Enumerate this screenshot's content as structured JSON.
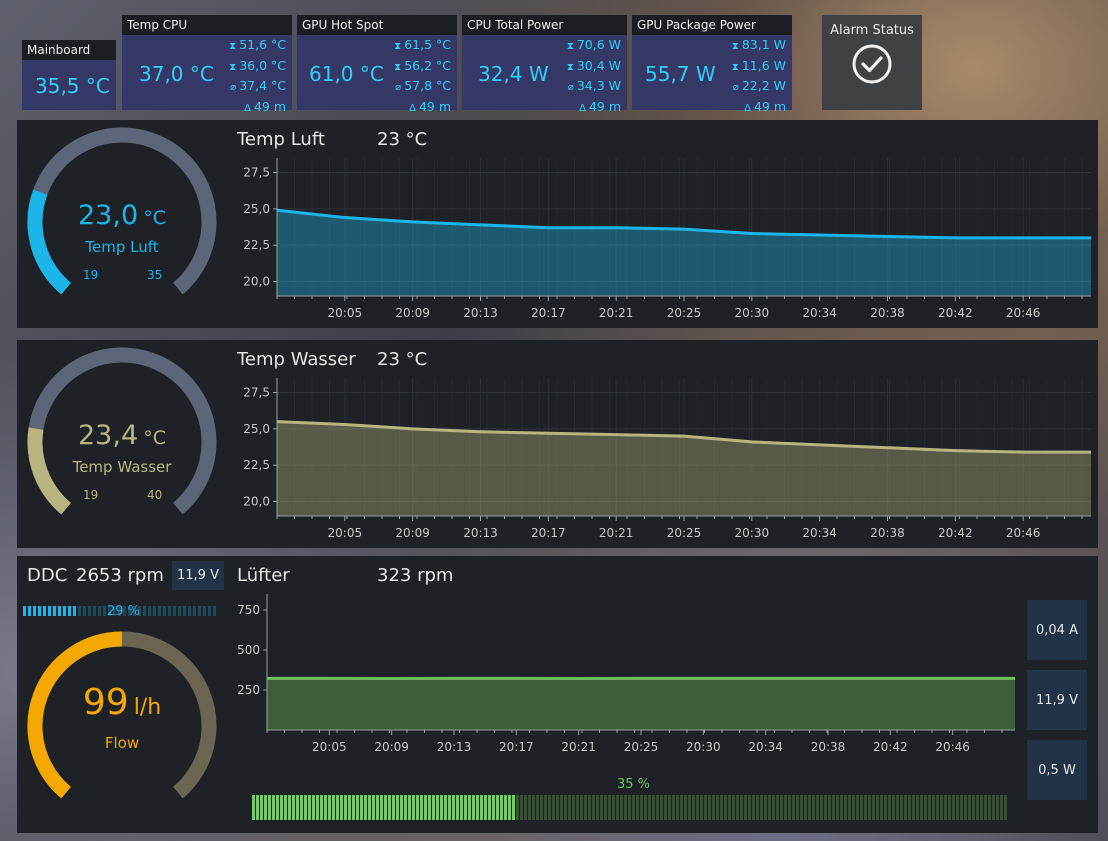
{
  "tiles": {
    "mainboard": {
      "label": "Mainboard",
      "value": "35,5 °C"
    },
    "temp_cpu": {
      "label": "Temp CPU",
      "value": "37,0 °C",
      "max": "51,6 °C",
      "min": "36,0 °C",
      "avg": "37,4 °C",
      "dur": "49 m"
    },
    "gpu_hotspot": {
      "label": "GPU Hot Spot",
      "value": "61,0 °C",
      "max": "61,5 °C",
      "min": "56,2 °C",
      "avg": "57,8 °C",
      "dur": "49 m"
    },
    "cpu_power": {
      "label": "CPU Total Power",
      "value": "32,4 W",
      "max": "70,6 W",
      "min": "30,4 W",
      "avg": "34,3 W",
      "dur": "49 m"
    },
    "gpu_power": {
      "label": "GPU Package Power",
      "value": "55,7 W",
      "max": "83,1 W",
      "min": "11,6 W",
      "avg": "22,2 W",
      "dur": "49 m"
    },
    "alarm": {
      "label": "Alarm Status"
    }
  },
  "icons": {
    "max": "hourglass-top-icon",
    "min": "hourglass-bottom-icon",
    "avg": "average-icon",
    "dur": "delta-time-icon",
    "alarm": "check-circle-icon"
  },
  "panels": {
    "luft": {
      "gauge_value": "23,0",
      "gauge_unit": "°C",
      "gauge_label": "Temp Luft",
      "gauge_min": "19",
      "gauge_max": "35",
      "fill_fraction": 0.25,
      "title": "Temp Luft",
      "current": "23 °C"
    },
    "wasser": {
      "gauge_value": "23,4",
      "gauge_unit": "°C",
      "gauge_label": "Temp Wasser",
      "gauge_min": "19",
      "gauge_max": "40",
      "fill_fraction": 0.21,
      "title": "Temp Wasser",
      "current": "23 °C"
    },
    "pump": {
      "name": "DDC",
      "rpm": "2653 rpm",
      "voltage": "11,9 V",
      "bar_percent_label": "29 %",
      "bar_fraction": 0.29,
      "flow_value": "99",
      "flow_unit": "l/h",
      "flow_label": "Flow",
      "flow_fraction": 0.5
    },
    "fan": {
      "title": "Lüfter",
      "current": "323 rpm",
      "bar_percent_label": "35 %",
      "bar_fraction": 0.35,
      "current_a": "0,04 A",
      "voltage": "11,9 V",
      "power": "0,5 W"
    }
  },
  "colors": {
    "luft": "#1cb5ea",
    "wasser": "#b8b581",
    "flow": "#f5a800",
    "fan": "#6fbf5f",
    "tile_value": "#2fd0f5"
  },
  "chart_data": [
    {
      "type": "area",
      "name": "temp-luft",
      "x": [
        "20:01",
        "20:05",
        "20:09",
        "20:13",
        "20:17",
        "20:21",
        "20:25",
        "20:30",
        "20:34",
        "20:38",
        "20:42",
        "20:46",
        "20:49"
      ],
      "y": [
        24.9,
        24.4,
        24.1,
        23.9,
        23.7,
        23.7,
        23.6,
        23.3,
        23.2,
        23.1,
        23.0,
        23.0,
        23.0
      ],
      "xticks": [
        "20:05",
        "20:09",
        "20:13",
        "20:17",
        "20:21",
        "20:25",
        "20:30",
        "20:34",
        "20:38",
        "20:42",
        "20:46"
      ],
      "yticks": [
        "20,0",
        "22,5",
        "25,0",
        "27,5"
      ],
      "ylim": [
        19.0,
        28.5
      ],
      "color": "#1cb5ea",
      "grid": true
    },
    {
      "type": "area",
      "name": "temp-wasser",
      "x": [
        "20:01",
        "20:05",
        "20:09",
        "20:13",
        "20:17",
        "20:21",
        "20:25",
        "20:30",
        "20:34",
        "20:38",
        "20:42",
        "20:46",
        "20:49"
      ],
      "y": [
        25.5,
        25.3,
        25.0,
        24.8,
        24.7,
        24.6,
        24.5,
        24.1,
        23.9,
        23.7,
        23.5,
        23.4,
        23.4
      ],
      "xticks": [
        "20:05",
        "20:09",
        "20:13",
        "20:17",
        "20:21",
        "20:25",
        "20:30",
        "20:34",
        "20:38",
        "20:42",
        "20:46"
      ],
      "yticks": [
        "20,0",
        "22,5",
        "25,0",
        "27,5"
      ],
      "ylim": [
        19.0,
        28.5
      ],
      "color": "#b8b581",
      "grid": true
    },
    {
      "type": "area",
      "name": "luefter",
      "x": [
        "20:01",
        "20:05",
        "20:09",
        "20:13",
        "20:17",
        "20:21",
        "20:25",
        "20:30",
        "20:34",
        "20:38",
        "20:42",
        "20:46",
        "20:49"
      ],
      "y": [
        323,
        323,
        322,
        323,
        323,
        322,
        323,
        323,
        323,
        323,
        323,
        323,
        323
      ],
      "xticks": [
        "20:05",
        "20:09",
        "20:13",
        "20:17",
        "20:21",
        "20:25",
        "20:30",
        "20:34",
        "20:38",
        "20:42",
        "20:46"
      ],
      "yticks": [
        "250",
        "500",
        "750"
      ],
      "ylim": [
        0,
        850
      ],
      "color": "#6fbf5f",
      "grid": false
    }
  ]
}
